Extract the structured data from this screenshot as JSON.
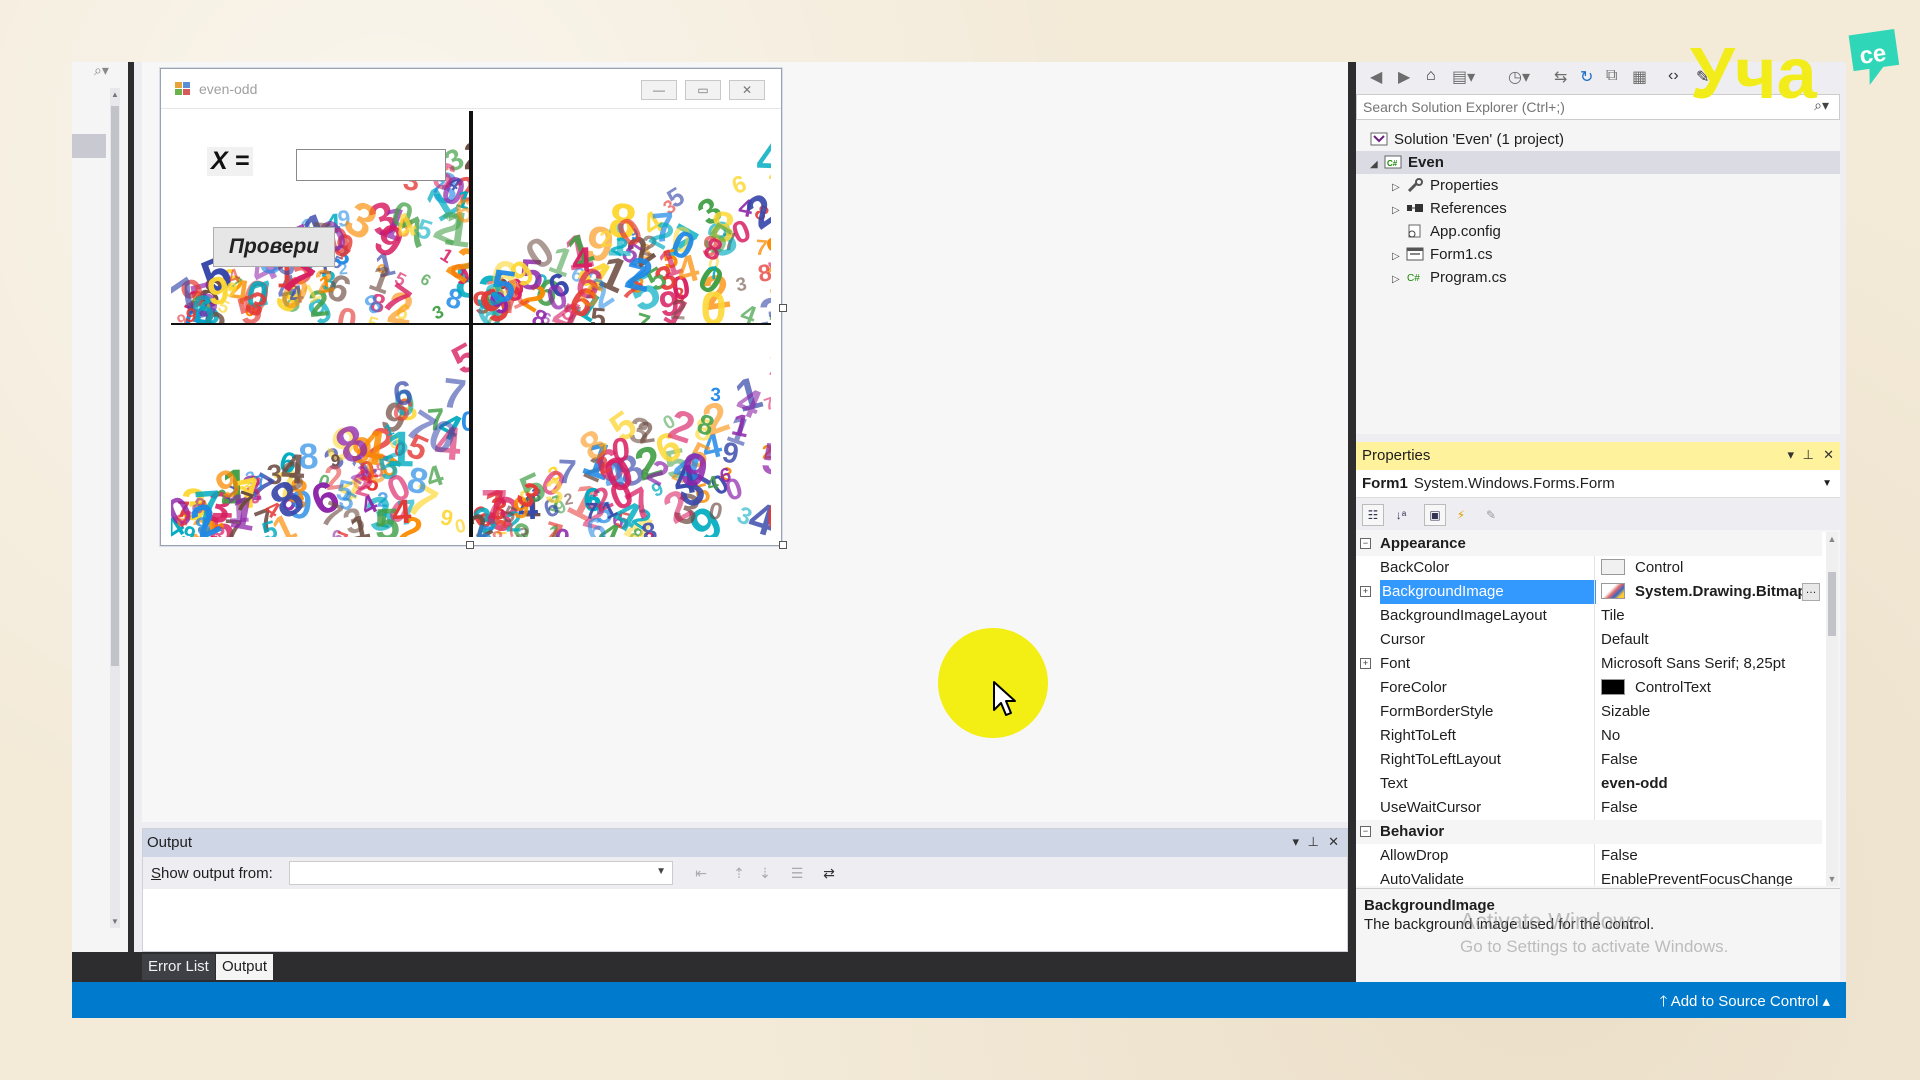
{
  "form_window": {
    "title": "even-odd",
    "x_label": "X =",
    "input_value": "",
    "check_button": "Провери"
  },
  "output": {
    "title": "Output",
    "show_output_label_prefix": "S",
    "show_output_label_rest": "how output from:",
    "combo_value": ""
  },
  "bottom_tabs": [
    "Error List",
    "Output"
  ],
  "statusbar": {
    "source_control": "Add to Source Control"
  },
  "solution_explorer": {
    "search_placeholder": "Search Solution Explorer (Ctrl+;)",
    "items": [
      {
        "label": "Solution 'Even' (1 project)",
        "icon": "solution-icon"
      },
      {
        "label": "Even",
        "icon": "csharp-project-icon"
      },
      {
        "label": "Properties",
        "icon": "wrench-icon"
      },
      {
        "label": "References",
        "icon": "references-icon"
      },
      {
        "label": "App.config",
        "icon": "config-file-icon"
      },
      {
        "label": "Form1.cs",
        "icon": "form-file-icon"
      },
      {
        "label": "Program.cs",
        "icon": "csharp-file-icon"
      }
    ]
  },
  "properties": {
    "title": "Properties",
    "object_name": "Form1",
    "object_type": "System.Windows.Forms.Form",
    "categories": [
      {
        "name": "Appearance",
        "rows": [
          {
            "name": "BackColor",
            "value": "Control",
            "swatch": "#f0f0f0"
          },
          {
            "name": "BackgroundImage",
            "value": "System.Drawing.Bitmap",
            "selected": true,
            "bold": true,
            "expandable": true
          },
          {
            "name": "BackgroundImageLayout",
            "value": "Tile"
          },
          {
            "name": "Cursor",
            "value": "Default"
          },
          {
            "name": "Font",
            "value": "Microsoft Sans Serif; 8,25pt",
            "expandable": true
          },
          {
            "name": "ForeColor",
            "value": "ControlText",
            "swatch": "#000000"
          },
          {
            "name": "FormBorderStyle",
            "value": "Sizable"
          },
          {
            "name": "RightToLeft",
            "value": "No"
          },
          {
            "name": "RightToLeftLayout",
            "value": "False"
          },
          {
            "name": "Text",
            "value": "even-odd",
            "bold": true
          },
          {
            "name": "UseWaitCursor",
            "value": "False"
          }
        ]
      },
      {
        "name": "Behavior",
        "rows": [
          {
            "name": "AllowDrop",
            "value": "False"
          },
          {
            "name": "AutoValidate",
            "value": "EnablePreventFocusChange"
          }
        ]
      }
    ],
    "description_title": "BackgroundImage",
    "description_text": "The background image used for the control."
  },
  "watermark": {
    "line1": "Activate Windows",
    "line2": "Go to Settings to activate Windows."
  },
  "logo_text": "Уча",
  "logo_badge": "ce",
  "colors": {
    "statusbar": "#007acc",
    "selection": "#3399ff",
    "properties_header": "#fff29d",
    "cursor_highlight": "#f3ee14",
    "logo_yellow": "#f2ec1a",
    "logo_teal": "#2fd6b8"
  }
}
